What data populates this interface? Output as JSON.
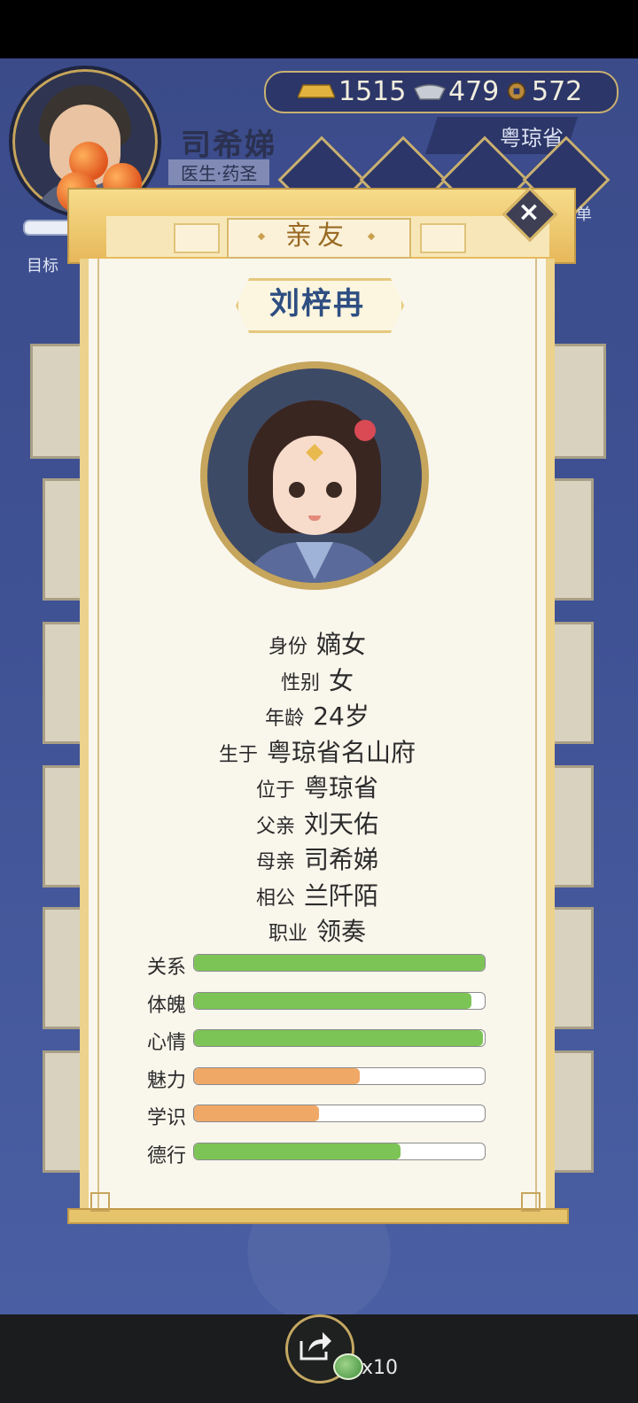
{
  "player": {
    "name": "司希娣",
    "title": "医生·药圣",
    "goal_label": "目标"
  },
  "currency": {
    "gold": "1515",
    "silver": "479",
    "coins": "572",
    "province": "粤琼省"
  },
  "menu_partial_label": "菜单",
  "modal": {
    "header": "亲友",
    "close_icon": "close-icon",
    "person": {
      "name": "刘梓冉",
      "info": [
        {
          "label": "身份",
          "value": "嫡女"
        },
        {
          "label": "性别",
          "value": "女"
        },
        {
          "label": "年龄",
          "value": "24岁"
        },
        {
          "label": "生于",
          "value": "粤琼省名山府"
        },
        {
          "label": "位于",
          "value": "粤琼省"
        },
        {
          "label": "父亲",
          "value": "刘天佑"
        },
        {
          "label": "母亲",
          "value": "司希娣"
        },
        {
          "label": "相公",
          "value": "兰阡陌"
        },
        {
          "label": "职业",
          "value": "领奏"
        }
      ],
      "stats": [
        {
          "label": "关系",
          "value": 1.0,
          "color": "#7cc455"
        },
        {
          "label": "体魄",
          "value": 0.955,
          "color": "#7cc455"
        },
        {
          "label": "心情",
          "value": 0.995,
          "color": "#7cc455"
        },
        {
          "label": "魅力",
          "value": 0.57,
          "color": "#f0a867"
        },
        {
          "label": "学识",
          "value": 0.43,
          "color": "#f0a867"
        },
        {
          "label": "德行",
          "value": 0.71,
          "color": "#7cc455"
        }
      ]
    }
  },
  "bottom": {
    "share_count": "x10"
  }
}
